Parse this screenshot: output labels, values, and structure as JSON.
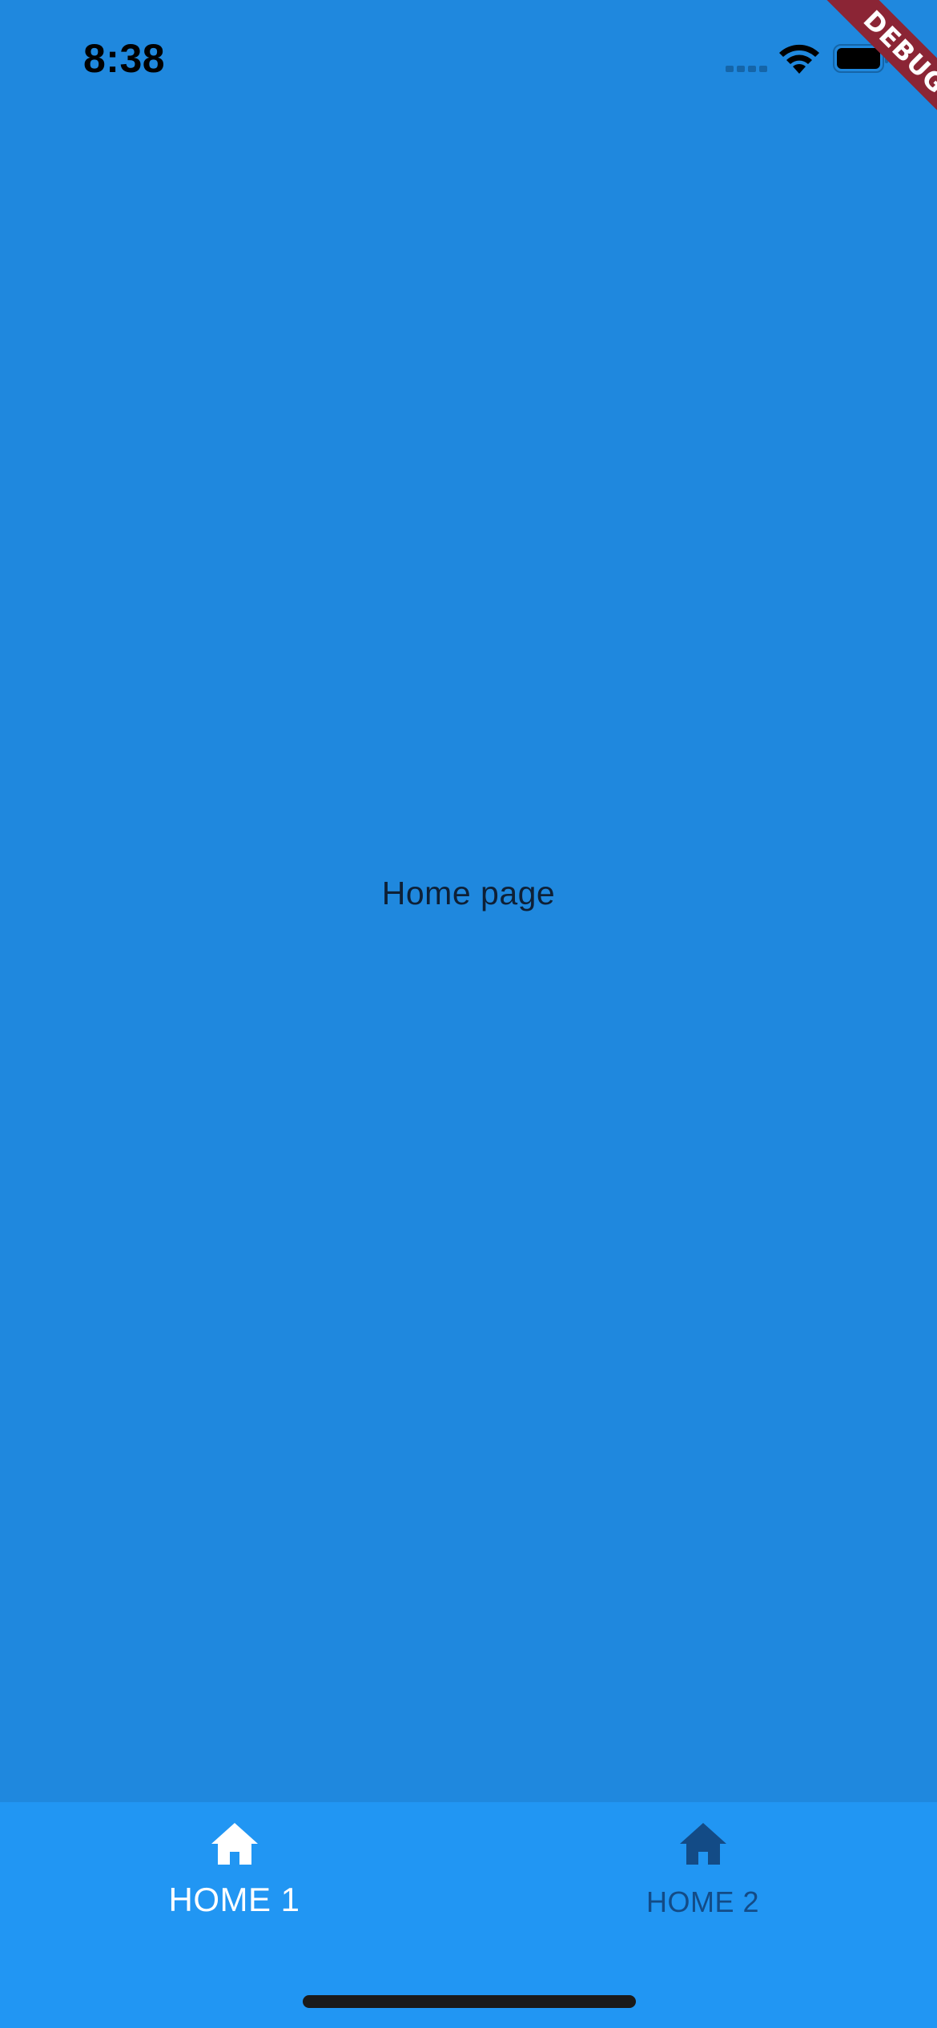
{
  "status_bar": {
    "time": "8:38",
    "signal_icon": "cellular-signal-icon",
    "wifi_icon": "wifi-icon",
    "battery_icon": "battery-icon"
  },
  "debug_banner": {
    "label": "DEBUG",
    "color": "#8B2535"
  },
  "main": {
    "text": "Home page",
    "background": "#1F88DE"
  },
  "bottom_nav": {
    "background": "#2196F3",
    "items": [
      {
        "label": "HOME 1",
        "icon": "home-icon",
        "selected": true,
        "color": "#FFFFFF"
      },
      {
        "label": "HOME 2",
        "icon": "home-icon",
        "selected": false,
        "color": "#134B86"
      }
    ]
  }
}
